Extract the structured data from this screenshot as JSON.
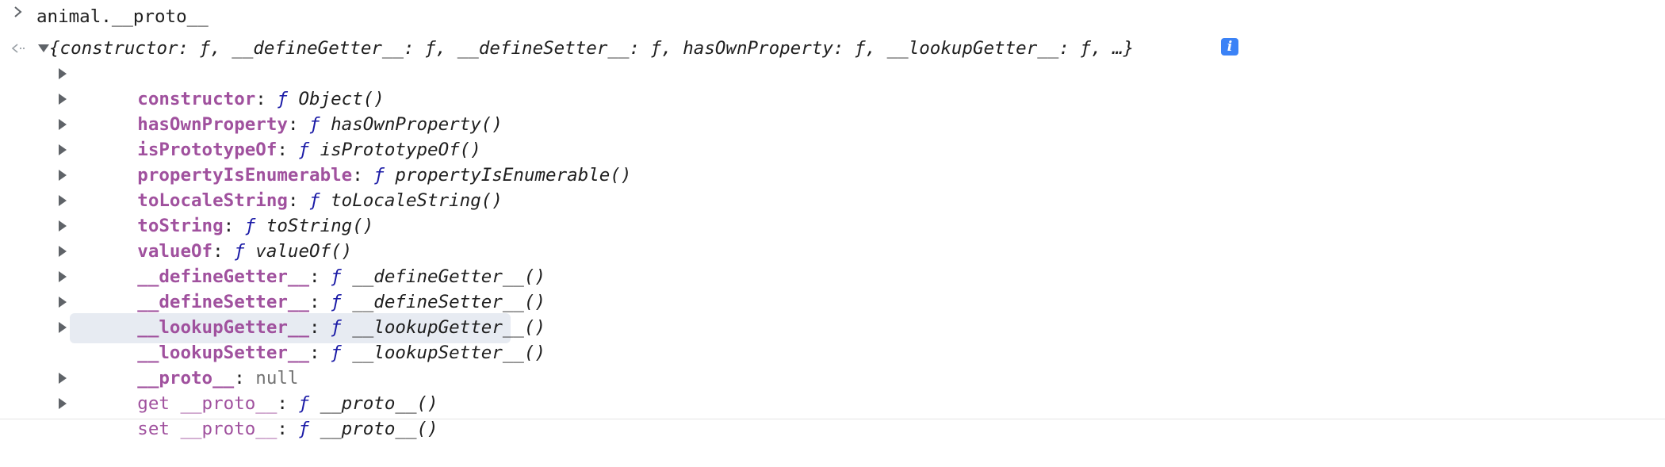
{
  "input": {
    "command": "animal.__proto__"
  },
  "summary": {
    "text": "{constructor: ƒ, __defineGetter__: ƒ, __defineSetter__: ƒ, hasOwnProperty: ƒ, __lookupGetter__: ƒ, …}",
    "info_badge": "i"
  },
  "properties": [
    {
      "key": "constructor",
      "sep": ": ",
      "f": "ƒ",
      "value": " Object()"
    },
    {
      "key": "hasOwnProperty",
      "sep": ": ",
      "f": "ƒ",
      "value": " hasOwnProperty()"
    },
    {
      "key": "isPrototypeOf",
      "sep": ": ",
      "f": "ƒ",
      "value": " isPrototypeOf()"
    },
    {
      "key": "propertyIsEnumerable",
      "sep": ": ",
      "f": "ƒ",
      "value": " propertyIsEnumerable()"
    },
    {
      "key": "toLocaleString",
      "sep": ": ",
      "f": "ƒ",
      "value": " toLocaleString()"
    },
    {
      "key": "toString",
      "sep": ": ",
      "f": "ƒ",
      "value": " toString()"
    },
    {
      "key": "valueOf",
      "sep": ": ",
      "f": "ƒ",
      "value": " valueOf()"
    },
    {
      "key": "__defineGetter__",
      "sep": ": ",
      "f": "ƒ",
      "value": " __defineGetter__()"
    },
    {
      "key": "__defineSetter__",
      "sep": ": ",
      "f": "ƒ",
      "value": " __defineSetter__()"
    },
    {
      "key": "__lookupGetter__",
      "sep": ": ",
      "f": "ƒ",
      "value": " __lookupGetter__()"
    },
    {
      "key": "__lookupSetter__",
      "sep": ": ",
      "f": "ƒ",
      "value": " __lookupSetter__()"
    }
  ],
  "proto_null": {
    "key": "__proto__",
    "sep": ": ",
    "value": "null"
  },
  "accessors": [
    {
      "key": "get __proto__",
      "sep": ": ",
      "f": "ƒ",
      "value": " __proto__()"
    },
    {
      "key": "set __proto__",
      "sep": ": ",
      "f": "ƒ",
      "value": " __proto__()"
    }
  ],
  "colors": {
    "key": "#a0519e",
    "function_f": "#1a1aa6",
    "null": "#727272",
    "info_badge": "#3b82f6",
    "hover_row": "#e7ebf2"
  },
  "icons": {
    "prompt": "chevron-right-icon",
    "result": "result-arrow-icon",
    "expand": "triangle-right-icon",
    "collapse": "triangle-down-icon",
    "info": "info-icon"
  }
}
